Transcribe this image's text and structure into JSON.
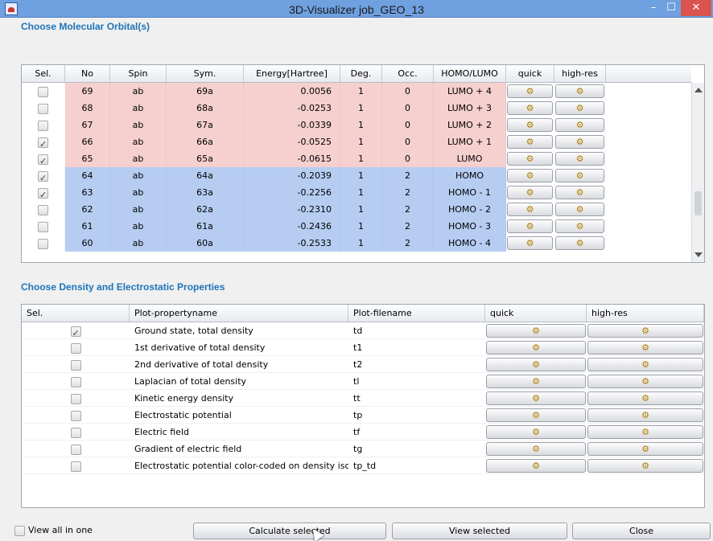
{
  "window": {
    "title": "3D-Visualizer job_GEO_13",
    "minimize": "–",
    "maximize": "☐",
    "close": "✕"
  },
  "orbitals": {
    "section_title": "Choose Molecular Orbital(s)",
    "columns": [
      "Sel.",
      "No",
      "Spin",
      "Sym.",
      "Energy[Hartree]",
      "Deg.",
      "Occ.",
      "HOMO/LUMO",
      "quick",
      "high-res"
    ],
    "rows": [
      {
        "checked": false,
        "no": "69",
        "spin": "ab",
        "sym": "69a",
        "energy": "0.0056",
        "deg": "1",
        "occ": "0",
        "hl": "LUMO + 4",
        "color": "pink"
      },
      {
        "checked": false,
        "no": "68",
        "spin": "ab",
        "sym": "68a",
        "energy": "-0.0253",
        "deg": "1",
        "occ": "0",
        "hl": "LUMO + 3",
        "color": "pink"
      },
      {
        "checked": false,
        "no": "67",
        "spin": "ab",
        "sym": "67a",
        "energy": "-0.0339",
        "deg": "1",
        "occ": "0",
        "hl": "LUMO + 2",
        "color": "pink"
      },
      {
        "checked": true,
        "no": "66",
        "spin": "ab",
        "sym": "66a",
        "energy": "-0.0525",
        "deg": "1",
        "occ": "0",
        "hl": "LUMO + 1",
        "color": "pink"
      },
      {
        "checked": true,
        "no": "65",
        "spin": "ab",
        "sym": "65a",
        "energy": "-0.0615",
        "deg": "1",
        "occ": "0",
        "hl": "LUMO",
        "color": "pink"
      },
      {
        "checked": true,
        "no": "64",
        "spin": "ab",
        "sym": "64a",
        "energy": "-0.2039",
        "deg": "1",
        "occ": "2",
        "hl": "HOMO",
        "color": "blue"
      },
      {
        "checked": true,
        "no": "63",
        "spin": "ab",
        "sym": "63a",
        "energy": "-0.2256",
        "deg": "1",
        "occ": "2",
        "hl": "HOMO - 1",
        "color": "blue"
      },
      {
        "checked": false,
        "no": "62",
        "spin": "ab",
        "sym": "62a",
        "energy": "-0.2310",
        "deg": "1",
        "occ": "2",
        "hl": "HOMO - 2",
        "color": "blue"
      },
      {
        "checked": false,
        "no": "61",
        "spin": "ab",
        "sym": "61a",
        "energy": "-0.2436",
        "deg": "1",
        "occ": "2",
        "hl": "HOMO - 3",
        "color": "blue"
      },
      {
        "checked": false,
        "no": "60",
        "spin": "ab",
        "sym": "60a",
        "energy": "-0.2533",
        "deg": "1",
        "occ": "2",
        "hl": "HOMO - 4",
        "color": "blue"
      }
    ],
    "colors": {
      "pink": "#f6cfcf",
      "blue": "#b6cdf1"
    }
  },
  "properties": {
    "section_title": "Choose Density and Electrostatic Properties",
    "columns": [
      "Sel.",
      "Plot-propertyname",
      "Plot-filename",
      "quick",
      "high-res"
    ],
    "rows": [
      {
        "checked": true,
        "name": "Ground state, total density",
        "file": "td"
      },
      {
        "checked": false,
        "name": "1st derivative of total density",
        "file": "t1"
      },
      {
        "checked": false,
        "name": "2nd derivative of total density",
        "file": "t2"
      },
      {
        "checked": false,
        "name": "Laplacian of total density",
        "file": "tl"
      },
      {
        "checked": false,
        "name": "Kinetic energy density",
        "file": "tt"
      },
      {
        "checked": false,
        "name": "Electrostatic potential",
        "file": "tp"
      },
      {
        "checked": false,
        "name": "Electric field",
        "file": "tf"
      },
      {
        "checked": false,
        "name": "Gradient of electric field",
        "file": "tg"
      },
      {
        "checked": false,
        "name": "Electrostatic potential color-coded on density isos...",
        "file": "tp_td"
      }
    ]
  },
  "footer": {
    "view_all": "View all in one",
    "calculate": "Calculate selected",
    "view_selected": "View selected",
    "close": "Close"
  },
  "icons": {
    "gear": "gear-icon"
  }
}
